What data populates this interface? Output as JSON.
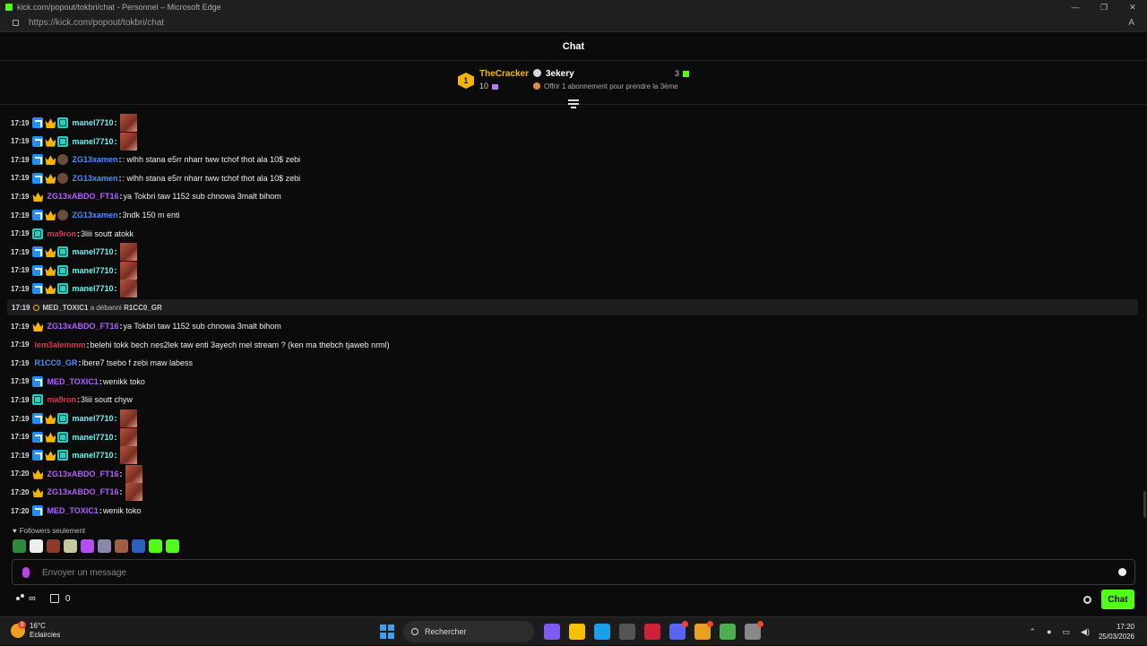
{
  "window": {
    "title": "kick.com/popout/tokbri/chat - Personnel – Microsoft Edge",
    "url": "https://kick.com/popout/tokbri/chat",
    "controls": [
      "—",
      "❐",
      "✕"
    ],
    "read_aloud": "A"
  },
  "header": {
    "title": "Chat"
  },
  "pinned": {
    "rank": "1",
    "top_gifter": "TheCracker",
    "gift_count": "10",
    "user": "3ekery",
    "right_count": "3",
    "offer_text": "Offrir 1 abonnement pour prendre la 3ème"
  },
  "messages": [
    {
      "time": "17:19",
      "badges": [
        "staff",
        "crown",
        "og"
      ],
      "user": "manel7710",
      "color": "#6ef0f0",
      "sep": ":",
      "text": "",
      "emote": true
    },
    {
      "time": "17:19",
      "badges": [
        "staff",
        "crown",
        "og"
      ],
      "user": "manel7710",
      "color": "#6ef0f0",
      "sep": ":",
      "text": "",
      "emote": true
    },
    {
      "time": "17:19",
      "badges": [
        "staff",
        "crown",
        "avatar"
      ],
      "user": "ZG13xamen",
      "color": "#4a8cff",
      "sep": ":",
      "text": ": wlhh stana e5rr nharr tww tchof thot ala 10$ zebi",
      "emote": false
    },
    {
      "time": "17:19",
      "badges": [
        "staff",
        "crown",
        "avatar"
      ],
      "user": "ZG13xamen",
      "color": "#4a8cff",
      "sep": ":",
      "text": ": wlhh stana e5rr nharr tww tchof thot ala 10$ zebi",
      "emote": false
    },
    {
      "time": "17:19",
      "badges": [
        "crown"
      ],
      "user": "ZG13xABDO_FT16",
      "color": "#b35cff",
      "sep": ":",
      "text": " ya Tokbri taw 1152 sub chnowa 3malt bihom",
      "emote": false
    },
    {
      "time": "17:19",
      "badges": [
        "staff",
        "crown",
        "avatar"
      ],
      "user": "ZG13xamen",
      "color": "#4a8cff",
      "sep": ":",
      "text": " 3ndk 150 m enti",
      "emote": false
    },
    {
      "time": "17:19",
      "badges": [
        "og"
      ],
      "user": "ma9ron",
      "color": "#e0314e",
      "sep": ":",
      "text": " 3liii soutt atokk",
      "emote": false
    },
    {
      "time": "17:19",
      "badges": [
        "staff",
        "crown",
        "og"
      ],
      "user": "manel7710",
      "color": "#6ef0f0",
      "sep": ":",
      "text": "",
      "emote": true
    },
    {
      "time": "17:19",
      "badges": [
        "staff",
        "crown",
        "og"
      ],
      "user": "manel7710",
      "color": "#6ef0f0",
      "sep": ":",
      "text": "",
      "emote": true
    },
    {
      "time": "17:19",
      "badges": [
        "staff",
        "crown",
        "og"
      ],
      "user": "manel7710",
      "color": "#6ef0f0",
      "sep": ":",
      "text": "",
      "emote": true
    }
  ],
  "system": {
    "time": "17:19",
    "actor": "MED_TOXIC1",
    "action": "a débanni",
    "target": "R1CC0_GR"
  },
  "messages2": [
    {
      "time": "17:19",
      "badges": [
        "crown"
      ],
      "user": "ZG13xABDO_FT16",
      "color": "#b35cff",
      "sep": ":",
      "text": " ya Tokbri taw 1152 sub chnowa 3malt bihom",
      "emote": false
    },
    {
      "time": "17:19",
      "badges": [],
      "user": "lem3alemmm",
      "color": "#e0314e",
      "sep": ":",
      "text": " belehi tokk bech nes2lek taw enti 3ayech mel stream ? (ken ma thebch tjaweb nrml)",
      "emote": false
    },
    {
      "time": "17:19",
      "badges": [],
      "user": "R1CC0_GR",
      "color": "#4a8cff",
      "sep": ":",
      "text": " lbere7 tsebo f zebi maw labess",
      "emote": false
    },
    {
      "time": "17:19",
      "badges": [
        "staff"
      ],
      "user": "MED_TOXIC1",
      "color": "#b35cff",
      "sep": ":",
      "text": " wenikk toko",
      "emote": false
    },
    {
      "time": "17:19",
      "badges": [
        "og"
      ],
      "user": "ma9ron",
      "color": "#e0314e",
      "sep": ":",
      "text": " 3liii soutt chyw",
      "emote": false
    },
    {
      "time": "17:19",
      "badges": [
        "staff",
        "crown",
        "og"
      ],
      "user": "manel7710",
      "color": "#6ef0f0",
      "sep": ":",
      "text": "",
      "emote": true
    },
    {
      "time": "17:19",
      "badges": [
        "staff",
        "crown",
        "og"
      ],
      "user": "manel7710",
      "color": "#6ef0f0",
      "sep": ":",
      "text": "",
      "emote": true
    },
    {
      "time": "17:19",
      "badges": [
        "staff",
        "crown",
        "og"
      ],
      "user": "manel7710",
      "color": "#6ef0f0",
      "sep": ":",
      "text": "",
      "emote": true
    },
    {
      "time": "17:20",
      "badges": [
        "crown"
      ],
      "user": "ZG13xABDO_FT16",
      "color": "#b35cff",
      "sep": ":",
      "text": "",
      "emote": true
    },
    {
      "time": "17:20",
      "badges": [
        "crown"
      ],
      "user": "ZG13xABDO_FT16",
      "color": "#b35cff",
      "sep": ":",
      "text": "",
      "emote": true
    },
    {
      "time": "17:20",
      "badges": [
        "staff"
      ],
      "user": "MED_TOXIC1",
      "color": "#b35cff",
      "sep": ":",
      "text": " wenik toko",
      "emote": false
    }
  ],
  "followers_only": "Followers seulement",
  "quick_emote_colors": [
    "#2e8b3e",
    "#eeeeee",
    "#8a3b2c",
    "#c8c8a0",
    "#b44ef0",
    "#8888aa",
    "#a06040",
    "#2a60c0",
    "#53fc18",
    "#53fc18"
  ],
  "input": {
    "placeholder": "Envoyer un message"
  },
  "footer": {
    "infinity": "∞",
    "store_count": "0",
    "chat_button": "Chat"
  },
  "taskbar": {
    "temp": "16°C",
    "weather": "Eclaircies",
    "weather_badge": "3",
    "search": "Rechercher",
    "time": "17:20",
    "date": "25/03/2026",
    "icons": [
      "#7f5af0",
      "#f5c000",
      "#1aa0e8",
      "#555555",
      "#d0203a",
      "#5865f2",
      "#e8a020",
      "#4caf50",
      "#888888"
    ]
  },
  "colors": {
    "accent": "#53fc18",
    "background": "#0b0b0c"
  }
}
